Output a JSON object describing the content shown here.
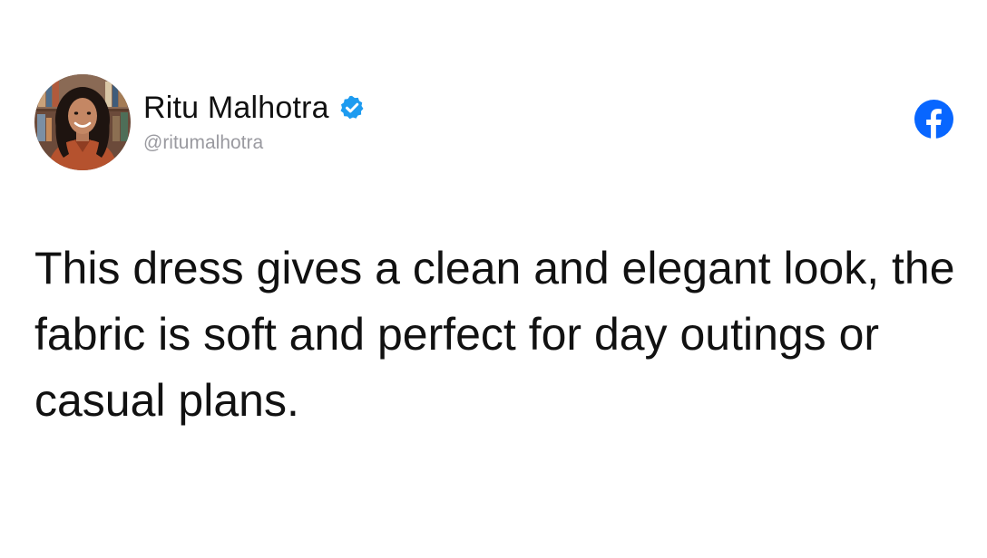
{
  "post": {
    "author": {
      "name": "Ritu Malhotra",
      "handle": "@ritumalhotra",
      "verified": true,
      "avatar_icon": "profile-photo"
    },
    "platform_icon": "facebook-icon",
    "text": "This dress gives a clean and elegant look, the fabric is soft and perfect for day outings or casual plans."
  },
  "colors": {
    "verified_badge": "#1d9bf0",
    "facebook_brand": "#0866ff",
    "text_primary": "#111111",
    "text_secondary": "#9a9aa0",
    "background": "#ffffff"
  }
}
